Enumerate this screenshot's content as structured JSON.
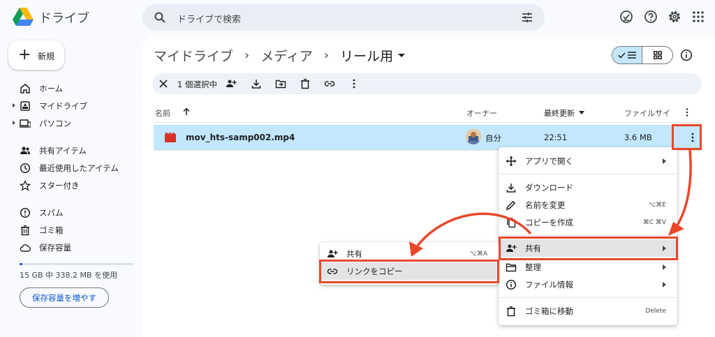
{
  "app": {
    "title": "ドライブ"
  },
  "search": {
    "placeholder": "ドライブで検索"
  },
  "sidebar": {
    "new_label": "新規",
    "items": [
      {
        "label": "ホーム",
        "icon": "home-icon"
      },
      {
        "label": "マイドライブ",
        "icon": "my-drive-icon"
      },
      {
        "label": "パソコン",
        "icon": "computers-icon"
      },
      {
        "label": "共有アイテム",
        "icon": "shared-icon"
      },
      {
        "label": "最近使用したアイテム",
        "icon": "recent-icon"
      },
      {
        "label": "スター付き",
        "icon": "star-icon"
      },
      {
        "label": "スパム",
        "icon": "spam-icon"
      },
      {
        "label": "ゴミ箱",
        "icon": "trash-icon"
      },
      {
        "label": "保存容量",
        "icon": "cloud-icon"
      }
    ],
    "storage_text": "15 GB 中 338.2 MB を使用",
    "storage_fraction": 0.022,
    "get_storage_label": "保存容量を増やす"
  },
  "breadcrumb": {
    "items": [
      "マイドライブ",
      "メディア",
      "リール用"
    ],
    "separator": "›"
  },
  "selection_bar": {
    "count_label": "1 個選択中"
  },
  "columns": {
    "name": "名前",
    "owner": "オーナー",
    "modified": "最終更新",
    "size": "ファイルサイ"
  },
  "file": {
    "name": "mov_hts-samp002.mp4",
    "owner": "自分",
    "modified": "22:51",
    "size": "3.6 MB"
  },
  "context_menu": {
    "open_with": "アプリで開く",
    "download": "ダウンロード",
    "rename": "名前を変更",
    "rename_shortcut": "⌥⌘E",
    "make_copy": "コピーを作成",
    "make_copy_shortcut": "⌘C ⌘V",
    "share": "共有",
    "organize": "整理",
    "file_info": "ファイル情報",
    "trash": "ゴミ箱に移動",
    "trash_shortcut": "Delete"
  },
  "share_submenu": {
    "share": "共有",
    "share_shortcut": "⌥⌘A",
    "copy_link": "リンクをコピー"
  },
  "colors": {
    "accent": "#0b57d0",
    "selection": "#c2e7ff",
    "annotation": "#e8472a"
  }
}
